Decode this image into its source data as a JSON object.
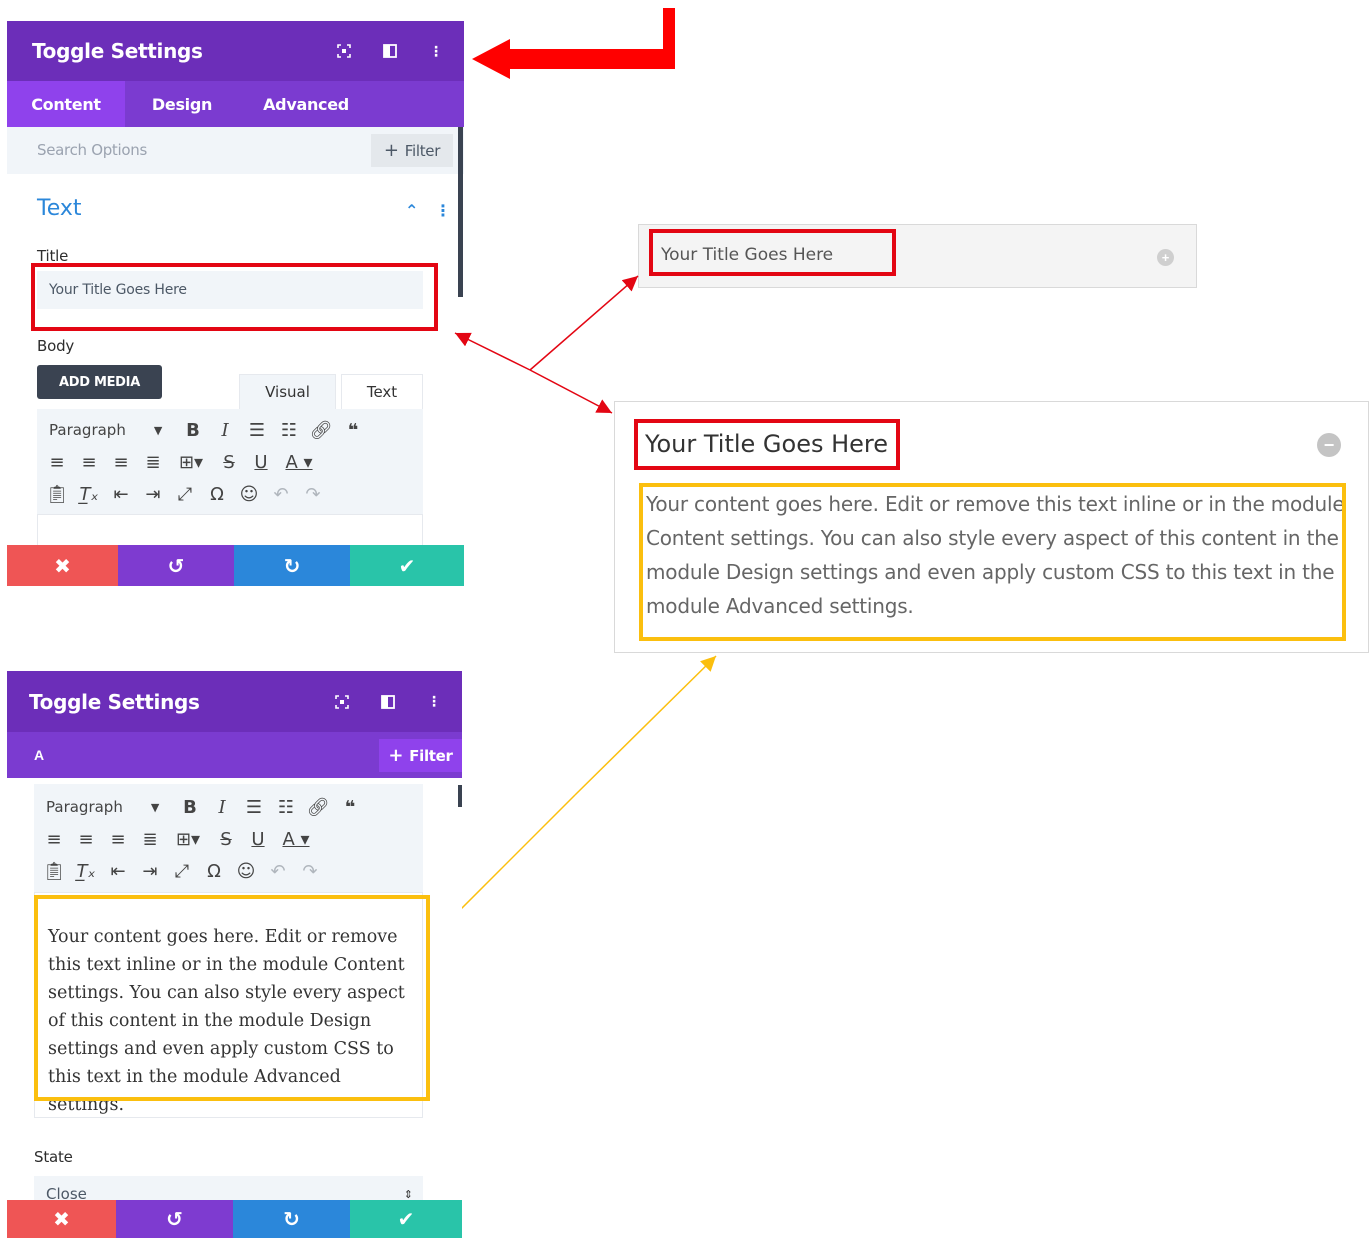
{
  "panel_top": {
    "title": "Toggle Settings",
    "tabs": [
      "Content",
      "Design",
      "Advanced"
    ],
    "search_placeholder": "Search Options",
    "filter_label": "Filter",
    "section_title": "Text",
    "title_label": "Title",
    "title_value": "Your Title Goes Here",
    "body_label": "Body",
    "add_media": "ADD MEDIA",
    "editor_tabs": [
      "Visual",
      "Text"
    ],
    "paragraph": "Paragraph"
  },
  "panel_bottom": {
    "title": "Toggle Settings",
    "subbar_label": "A",
    "filter_label": "Filter",
    "paragraph": "Paragraph",
    "body_text": "Your content goes here. Edit or remove this text inline or in the module Content settings. You can also style every aspect of this content in the module Design settings and even apply custom CSS to this text in the module Advanced settings.",
    "state_label": "State",
    "state_value": "Close"
  },
  "preview_closed": {
    "title": "Your Title Goes Here"
  },
  "preview_open": {
    "title": "Your Title Goes Here",
    "body": "Your content goes here. Edit or remove this text inline or in the module Content settings. You can also style every aspect of this content in the module Design settings and even apply custom CSS to this text in the module Advanced settings."
  },
  "colors": {
    "header_purple": "#6c2eb9",
    "tab_purple": "#7b3bd0",
    "active_purple": "#8f42ec",
    "cancel_red": "#ef5555",
    "undo_purple": "#7e3bd0",
    "redo_blue": "#2b87da",
    "save_green": "#29c4a9",
    "highlight_red": "#e30613",
    "highlight_yellow": "#fbbf0e"
  },
  "icons": [
    "expand-icon",
    "sidebar-icon",
    "more-options-icon",
    "plus-icon",
    "collapse-chevron-icon",
    "close-icon",
    "undo-icon",
    "redo-icon",
    "check-icon"
  ]
}
